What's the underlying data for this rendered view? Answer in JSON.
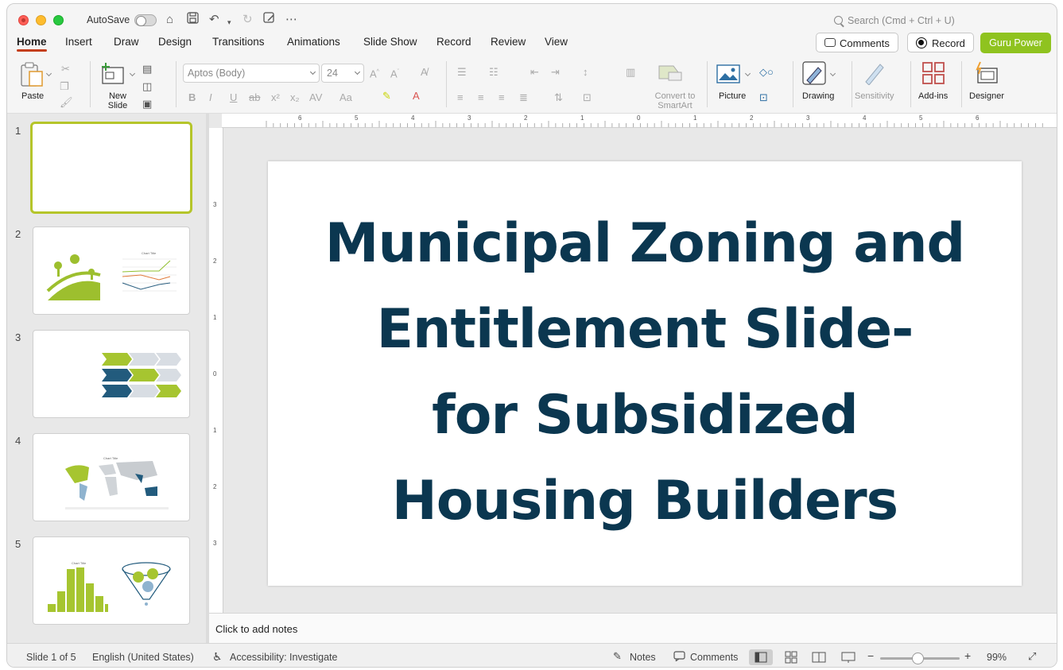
{
  "titlebar": {
    "autosave_label": "AutoSave",
    "search_placeholder": "Search (Cmd + Ctrl + U)"
  },
  "tabs": [
    "Home",
    "Insert",
    "Draw",
    "Design",
    "Transitions",
    "Animations",
    "Slide Show",
    "Record",
    "Review",
    "View"
  ],
  "active_tab": "Home",
  "actions": {
    "comments": "Comments",
    "record": "Record",
    "guru": "Guru Power"
  },
  "ribbon": {
    "paste": "Paste",
    "new_slide": "New Slide",
    "font_name": "Aptos (Body)",
    "font_size": "24",
    "convert_smartart": "Convert to SmartArt",
    "picture": "Picture",
    "drawing": "Drawing",
    "sensitivity": "Sensitivity",
    "addins": "Add-ins",
    "designer": "Designer"
  },
  "thumbnails": [
    {
      "number": "1",
      "selected": true
    },
    {
      "number": "2",
      "selected": false
    },
    {
      "number": "3",
      "selected": false
    },
    {
      "number": "4",
      "selected": false
    },
    {
      "number": "5",
      "selected": false
    }
  ],
  "slide": {
    "title_lines": [
      "Municipal Zoning and",
      "Entitlement Slide-",
      "for Subsidized",
      "Housing Builders"
    ]
  },
  "notes_placeholder": "Click to add notes",
  "status": {
    "slide_of": "Slide 1 of 5",
    "language": "English (United States)",
    "accessibility": "Accessibility: Investigate",
    "notes": "Notes",
    "comments": "Comments",
    "zoom": "99%"
  },
  "ruler": {
    "h_ticks": [
      "6",
      "5",
      "4",
      "3",
      "2",
      "1",
      "0",
      "1",
      "2",
      "3",
      "4",
      "5",
      "6"
    ],
    "v_ticks": [
      "3",
      "2",
      "1",
      "0",
      "1",
      "2",
      "3"
    ]
  },
  "colors": {
    "accent_tab": "#c43e1c",
    "guru": "#8fc31f",
    "title": "#0b3750",
    "selected_thumb": "#b5c52a"
  }
}
